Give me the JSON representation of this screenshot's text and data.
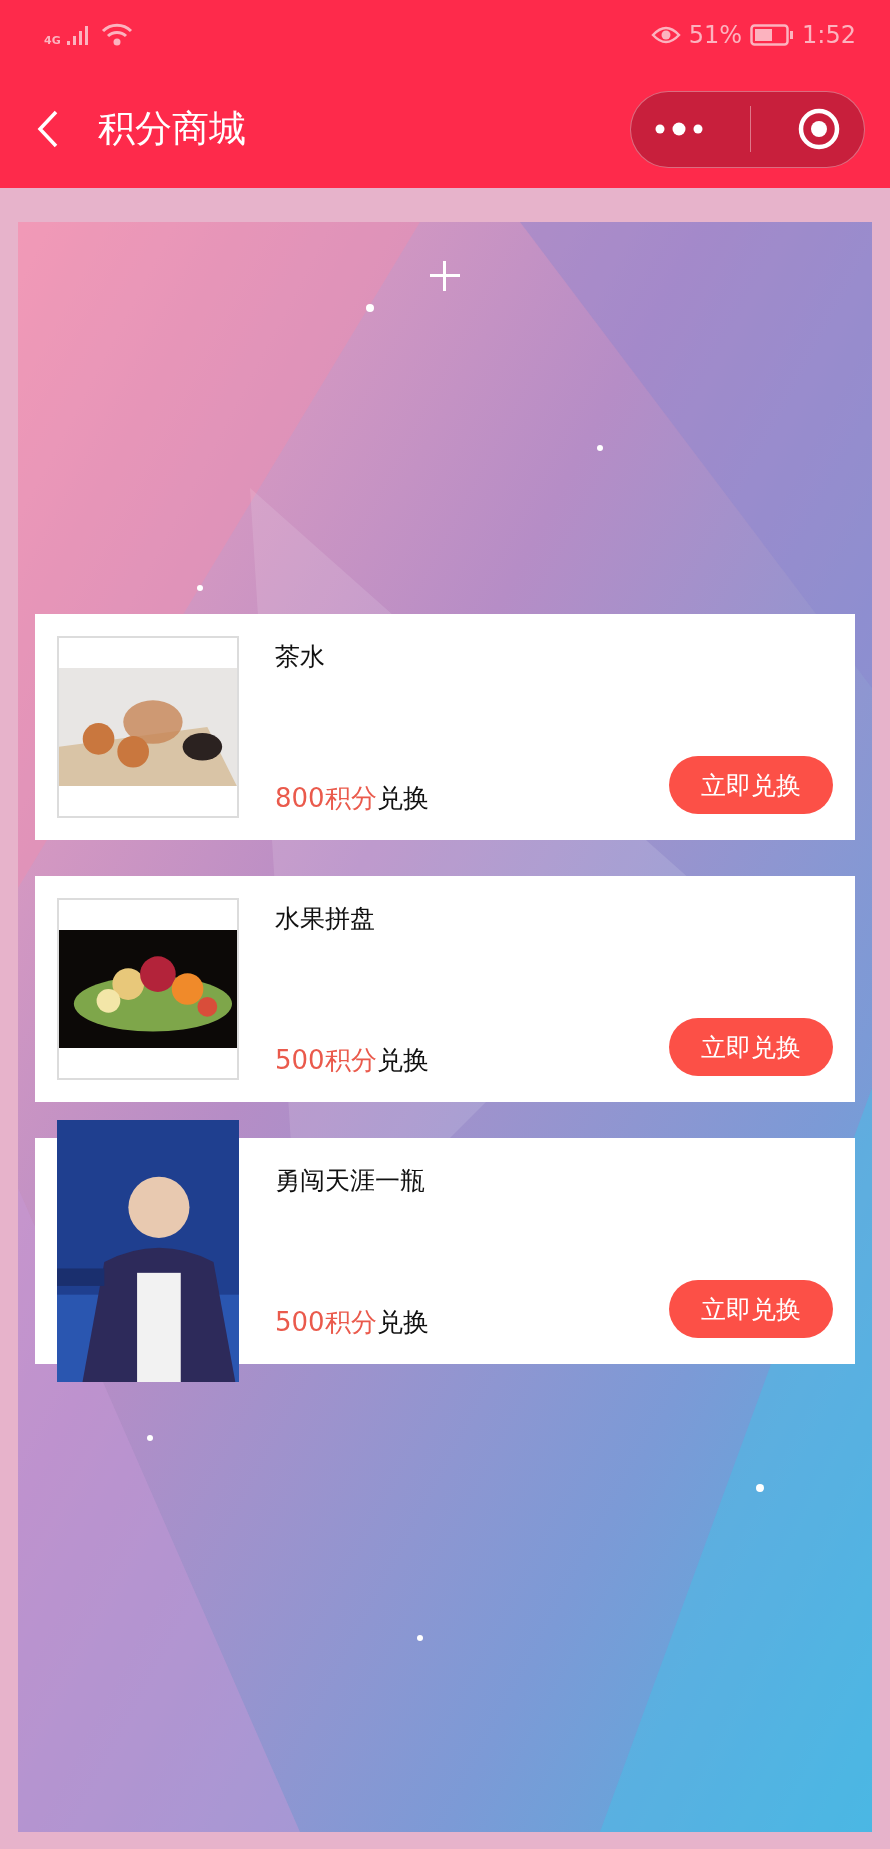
{
  "status_bar": {
    "network": "4G",
    "battery": "51%",
    "time": "1:52"
  },
  "header": {
    "title": "积分商城"
  },
  "products": [
    {
      "name": "茶水",
      "points": "800积分",
      "suffix": "兑换",
      "button": "立即兑换",
      "kind": "framed"
    },
    {
      "name": "水果拼盘",
      "points": "500积分",
      "suffix": "兑换",
      "button": "立即兑换",
      "kind": "framed"
    },
    {
      "name": "勇闯天涯一瓶",
      "points": "500积分",
      "suffix": "兑换",
      "button": "立即兑换",
      "kind": "poster"
    }
  ]
}
